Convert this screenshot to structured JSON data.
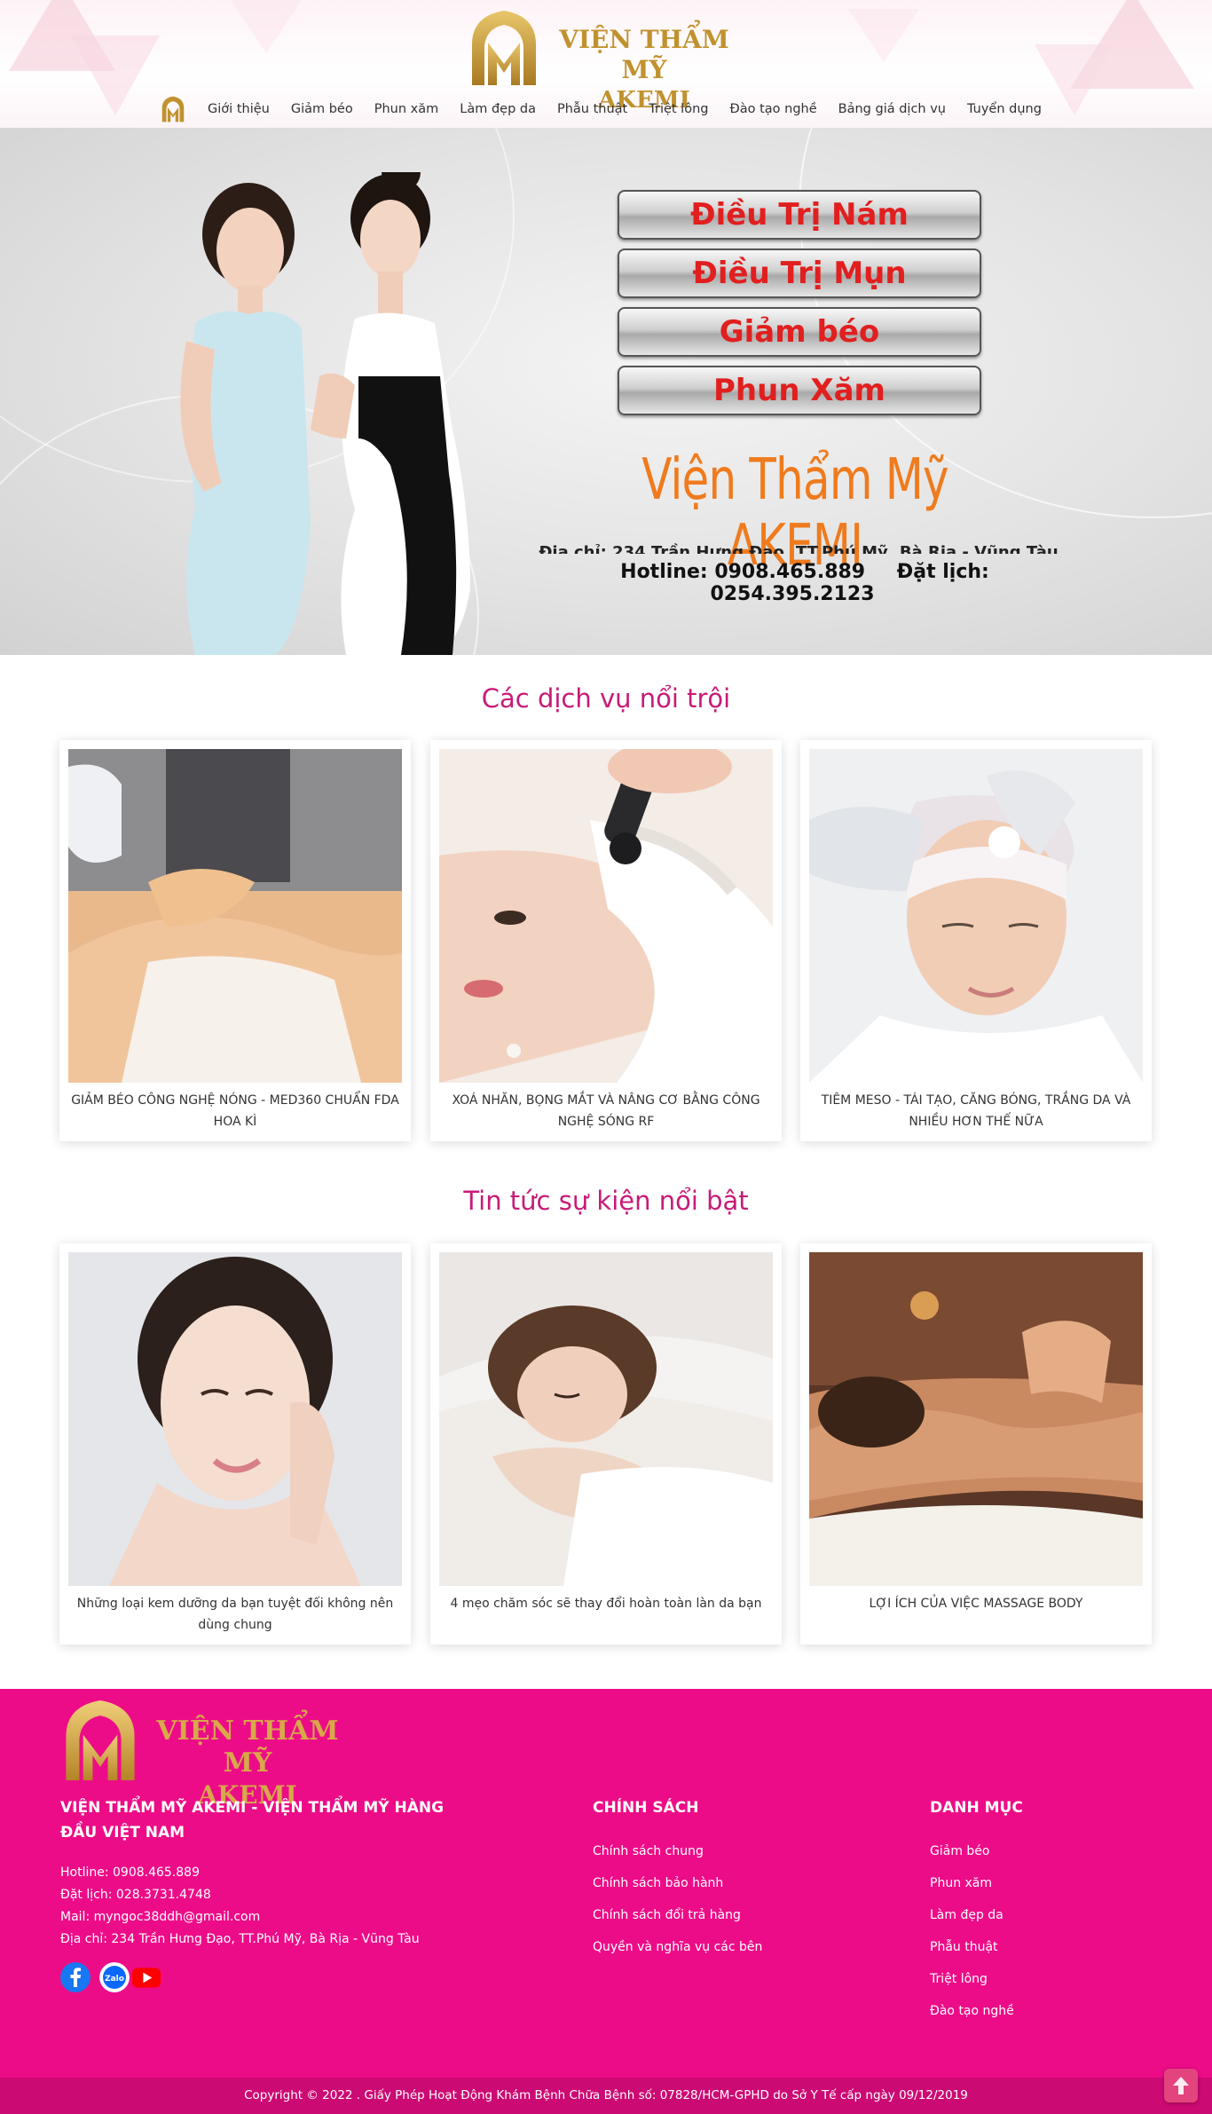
{
  "header": {
    "logo_line1": "VIỆN THẨM MỸ",
    "logo_line2": "AKEMI",
    "nav": [
      "Giới thiệu",
      "Giảm béo",
      "Phun xăm",
      "Làm đẹp da",
      "Phẫu thuật",
      "Triệt lông",
      "Đào tạo nghề",
      "Bảng giá dịch vụ",
      "Tuyển dụng"
    ]
  },
  "hero": {
    "buttons": [
      "Điều Trị Nám",
      "Điều Trị Mụn",
      "Giảm béo",
      "Phun Xăm"
    ],
    "title": "Viện Thẩm Mỹ AKEMI",
    "address": "Địa chỉ: 234 Trần Hưng Đạo, TT.Phú Mỹ, Bà Rịa - Vũng Tàu",
    "hotline": "Hotline: 0908.465.889",
    "booking": "Đặt lịch: 0254.395.2123"
  },
  "services": {
    "title": "Các dịch vụ nổi trội",
    "items": [
      {
        "caption": "GIẢM BÉO CÔNG NGHỆ NÓNG - MED360 CHUẨN FDA HOA KÌ"
      },
      {
        "caption": "XOÁ NHĂN, BỌNG MẮT VÀ NÂNG CƠ BẰNG CÔNG NGHỆ SÓNG RF"
      },
      {
        "caption": "TIÊM MESO - TÁI TẠO, CĂNG BÓNG, TRẮNG DA VÀ NHIỀU HƠN THẾ NỮA"
      }
    ]
  },
  "news": {
    "title": "Tin tức sự kiện nổi bật",
    "items": [
      {
        "caption": "Những loại kem dưỡng da bạn tuyệt đối không nên dùng chung"
      },
      {
        "caption": "4 mẹo chăm sóc sẽ thay đổi hoàn toàn làn da bạn"
      },
      {
        "caption": "LỢI ÍCH CỦA VIỆC MASSAGE BODY"
      }
    ]
  },
  "footer": {
    "logo_line1": "VIỆN THẨM MỸ",
    "logo_line2": "AKEMI",
    "about_heading": "VIỆN THẨM MỸ AKEMI - VIỆN THẨM MỸ HÀNG ĐẦU VIỆT NAM",
    "hotline": "Hotline: 0908.465.889",
    "booking": "Đặt lịch: 028.3731.4748",
    "mail": "Mail: myngoc38ddh@gmail.com",
    "address": "Địa chỉ: 234 Trần Hưng Đạo, TT.Phú Mỹ, Bà Rịa - Vũng Tàu",
    "policy_heading": "CHÍNH SÁCH",
    "policy_links": [
      "Chính sách chung",
      "Chính sách bảo hành",
      "Chính sách đổi trả hàng",
      "Quyền và nghĩa vụ các bên"
    ],
    "category_heading": "DANH MỤC",
    "category_links": [
      "Giảm béo",
      "Phun xăm",
      "Làm đẹp da",
      "Phẫu thuật",
      "Triệt lông",
      "Đào tạo nghề"
    ],
    "zalo_label": "Zalo",
    "copyright": "Copyright © 2022 . Giấy Phép Hoạt Động Khám Bệnh Chữa Bệnh số: 07828/HCM-GPHD do Sở Y Tế cấp ngày 09/12/2019"
  },
  "icons": [
    "home-logo-icon",
    "facebook-icon",
    "zalo-icon",
    "youtube-icon",
    "arrow-up-icon"
  ],
  "colors": {
    "brand_pink": "#ed0c87",
    "gold": "#c0922f",
    "title_pink": "#c71b77",
    "hero_orange": "#ef7b1e",
    "hero_red": "#e11f1f"
  }
}
